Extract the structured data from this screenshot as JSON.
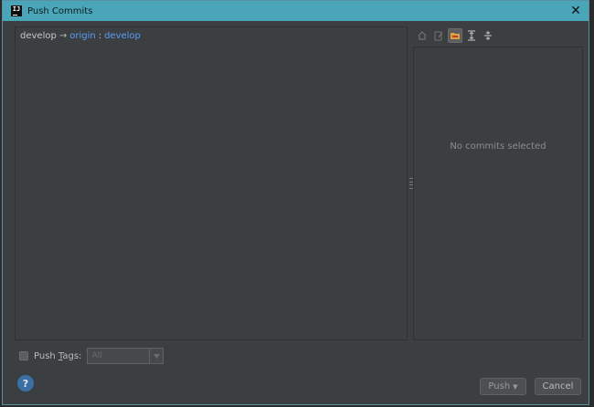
{
  "window": {
    "title": "Push Commits",
    "close_symbol": "✕"
  },
  "branch": {
    "local": "develop",
    "arrow": "→",
    "remote": "origin",
    "separator": ":",
    "remote_branch": "develop"
  },
  "details": {
    "empty_text": "No commits selected"
  },
  "toolbar": {
    "icons": [
      "home-icon",
      "edit-icon",
      "folder-icon",
      "expand-all-icon",
      "collapse-all-icon"
    ],
    "active_icon": "folder-icon"
  },
  "bottom": {
    "push_tags_label_prefix": "Push ",
    "push_tags_label_mnemonic": "T",
    "push_tags_label_suffix": "ags:",
    "tags_combo_value": "All",
    "help_label": "?",
    "push_label": "Push",
    "cancel_label": "Cancel"
  },
  "colors": {
    "title_bar": "#4aa5b8",
    "panel_bg": "#3c3f41",
    "remote_link": "#589df6"
  }
}
